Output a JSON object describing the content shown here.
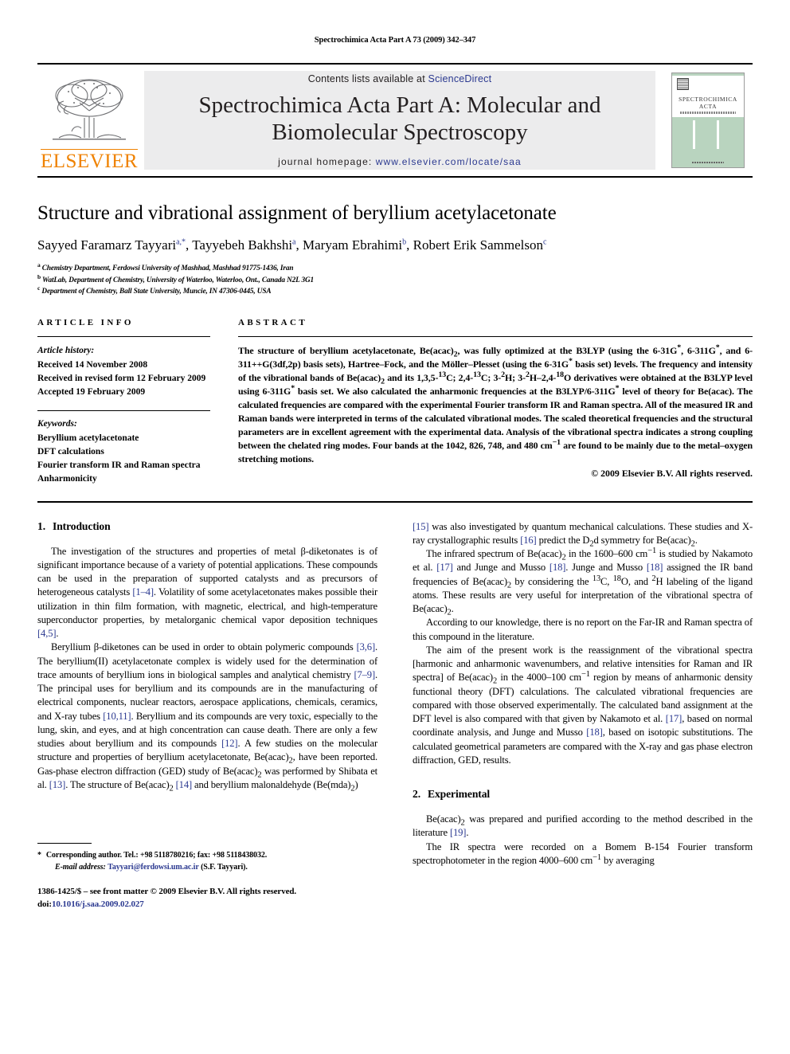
{
  "running_head": "Spectrochimica Acta Part A 73 (2009) 342–347",
  "masthead": {
    "publisher_name": "ELSEVIER",
    "contents_prefix": "Contents lists available at ",
    "contents_link": "ScienceDirect",
    "journal_title_line1": "Spectrochimica Acta Part A: Molecular and",
    "journal_title_line2": "Biomolecular Spectroscopy",
    "homepage_prefix": "journal homepage: ",
    "homepage_url": "www.elsevier.com/locate/saa",
    "cover_title_line1": "SPECTROCHIMICA",
    "cover_title_line2": "ACTA"
  },
  "title": "Structure and vibrational assignment of beryllium acetylacetonate",
  "authors_html": "Sayyed Faramarz Tayyari<sup>a,*</sup>, Tayyebeh Bakhshi<sup>a</sup>, Maryam Ebrahimi<sup>b</sup>, Robert Erik Sammelson<sup>c</sup>",
  "affiliations": [
    {
      "marker": "a",
      "text": "Chemistry Department, Ferdowsi University of Mashhad, Mashhad 91775-1436, Iran"
    },
    {
      "marker": "b",
      "text": "WatLab, Department of Chemistry, University of Waterloo, Waterloo, Ont., Canada N2L 3G1"
    },
    {
      "marker": "c",
      "text": "Department of Chemistry, Ball State University, Muncie, IN 47306-0445, USA"
    }
  ],
  "article_info": {
    "heading": "ARTICLE INFO",
    "history_label": "Article history:",
    "history": [
      "Received 14 November 2008",
      "Received in revised form 12 February 2009",
      "Accepted 19 February 2009"
    ],
    "keywords_label": "Keywords:",
    "keywords": [
      "Beryllium acetylacetonate",
      "DFT calculations",
      "Fourier transform IR and Raman spectra",
      "Anharmonicity"
    ]
  },
  "abstract": {
    "heading": "ABSTRACT",
    "body_html": "The structure of beryllium acetylacetonate, Be(acac)<sub>2</sub>, was fully optimized at the B3LYP (using the 6-31G<sup>*</sup>, 6-311G<sup>*</sup>, and 6-311++G(3df,2p) basis sets), Hartree–Fock, and the Möller–Plesset (using the 6-31G<sup>*</sup> basis set) levels. The frequency and intensity of the vibrational bands of Be(acac)<sub>2</sub> and its 1,3,5-<sup>13</sup>C; 2,4-<sup>13</sup>C; 3-<sup>2</sup>H; 3-<sup>2</sup>H–2,4-<sup>18</sup>O derivatives were obtained at the B3LYP level using 6-311G<sup>*</sup> basis set. We also calculated the anharmonic frequencies at the B3LYP/6-311G<sup>*</sup> level of theory for Be(acac). The calculated frequencies are compared with the experimental Fourier transform IR and Raman spectra. All of the measured IR and Raman bands were interpreted in terms of the calculated vibrational modes. The scaled theoretical frequencies and the structural parameters are in excellent agreement with the experimental data. Analysis of the vibrational spectra indicates a strong coupling between the chelated ring modes. Four bands at the 1042, 826, 748, and 480 cm<sup>−1</sup> are found to be mainly due to the metal–oxygen stretching motions.",
    "copyright": "© 2009 Elsevier B.V. All rights reserved."
  },
  "sections": {
    "introduction_num": "1.",
    "introduction_title": "Introduction",
    "experimental_num": "2.",
    "experimental_title": "Experimental"
  },
  "body": {
    "left": [
      "The investigation of the structures and properties of metal β-diketonates is of significant importance because of a variety of potential applications. These compounds can be used in the preparation of supported catalysts and as precursors of heterogeneous catalysts [1–4]. Volatility of some acetylacetonates makes possible their utilization in thin film formation, with magnetic, electrical, and high-temperature superconductor properties, by metalorganic chemical vapor deposition techniques [4,5].",
      "Beryllium β-diketones can be used in order to obtain polymeric compounds [3,6]. The beryllium(II) acetylacetonate complex is widely used for the determination of trace amounts of beryllium ions in biological samples and analytical chemistry [7–9]. The principal uses for beryllium and its compounds are in the manufacturing of electrical components, nuclear reactors, aerospace applications, chemicals, ceramics, and X-ray tubes [10,11]. Beryllium and its compounds are very toxic, especially to the lung, skin, and eyes, and at high concentration can cause death. There are only a few studies about beryllium and its compounds [12]. A few studies on the molecular structure and properties of beryllium acetylacetonate, Be(acac)2, have been reported. Gas-phase electron diffraction (GED) study of Be(acac)2 was performed by Shibata et al. [13]. The structure of Be(acac)2 [14] and beryllium malonaldehyde (Be(mda)2)"
    ],
    "right": [
      "[15] was also investigated by quantum mechanical calculations. These studies and X-ray crystallographic results [16] predict the D2d symmetry for Be(acac)2.",
      "The infrared spectrum of Be(acac)2 in the 1600–600 cm−1 is studied by Nakamoto et al. [17] and Junge and Musso [18]. Junge and Musso [18] assigned the IR band frequencies of Be(acac)2 by considering the 13C, 18O, and 2H labeling of the ligand atoms. These results are very useful for interpretation of the vibrational spectra of Be(acac)2.",
      "According to our knowledge, there is no report on the Far-IR and Raman spectra of this compound in the literature.",
      "The aim of the present work is the reassignment of the vibrational spectra [harmonic and anharmonic wavenumbers, and relative intensities for Raman and IR spectra] of Be(acac)2 in the 4000–100 cm−1 region by means of anharmonic density functional theory (DFT) calculations. The calculated vibrational frequencies are compared with those observed experimentally. The calculated band assignment at the DFT level is also compared with that given by Nakamoto et al. [17], based on normal coordinate analysis, and Junge and Musso [18], based on isotopic substitutions. The calculated geometrical parameters are compared with the X-ray and gas phase electron diffraction, GED, results.",
      "Be(acac)2 was prepared and purified according to the method described in the literature [19].",
      "The IR spectra were recorded on a Bomem B-154 Fourier transform spectrophotometer in the region 4000–600 cm−1 by averaging"
    ]
  },
  "footnote": {
    "star": "*",
    "corresponding": "Corresponding author. Tel.: +98 5118780216; fax: +98 5118438032.",
    "email_label": "E-mail address:",
    "email": "Tayyari@ferdowsi.um.ac.ir",
    "email_suffix": "(S.F. Tayyari).",
    "issn_line": "1386-1425/$ – see front matter © 2009 Elsevier B.V. All rights reserved.",
    "doi_label": "doi:",
    "doi_value": "10.1016/j.saa.2009.02.027"
  },
  "colors": {
    "link": "#2b3990",
    "elsevier_orange": "#ef8200",
    "masthead_bg": "#ececed",
    "cover_green": "#b9d4bf"
  }
}
